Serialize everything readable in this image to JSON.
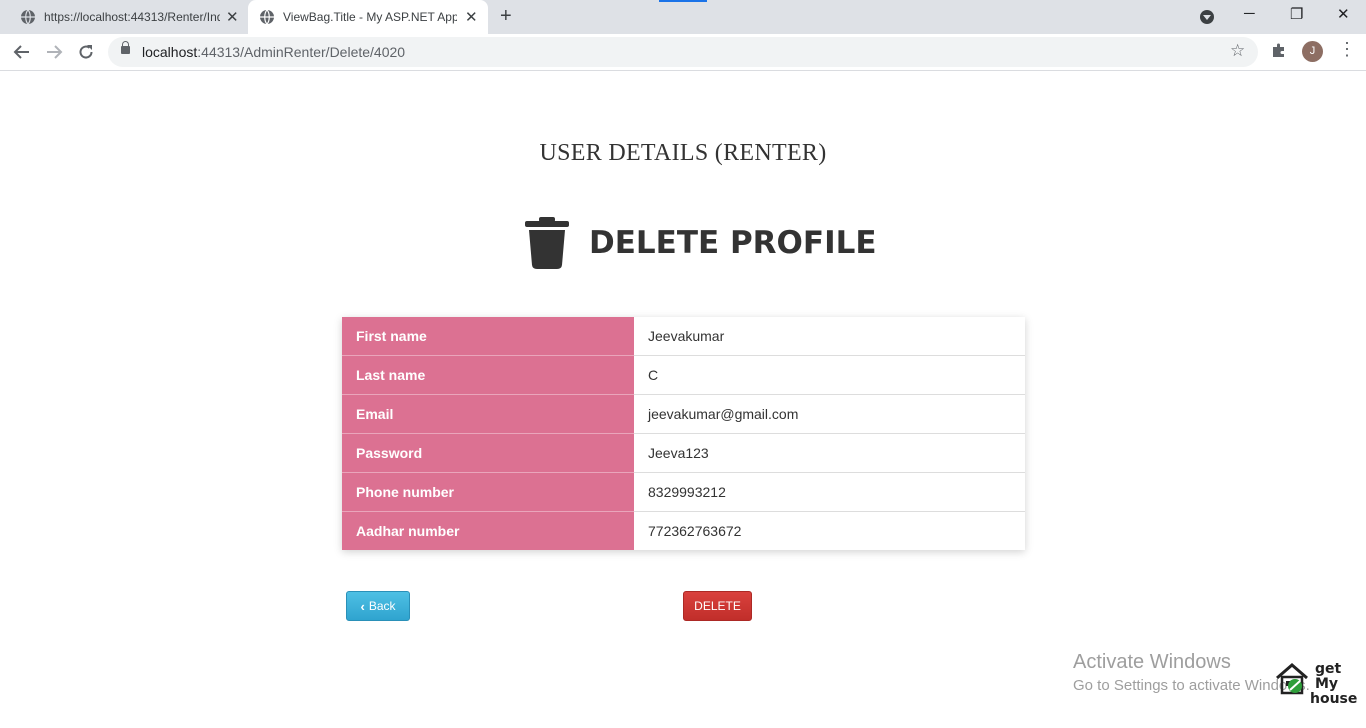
{
  "browser": {
    "tabs": [
      {
        "title": "https://localhost:44313/Renter/Index",
        "active": false
      },
      {
        "title": "ViewBag.Title - My ASP.NET Application",
        "active": true
      }
    ],
    "new_tab_icon": "+",
    "close_icon": "✕",
    "url_host": "localhost",
    "url_path": ":44313/AdminRenter/Delete/4020",
    "avatar_initial": "J",
    "window_controls": {
      "minimize": "─",
      "restore": "❐",
      "close": "✕"
    }
  },
  "page": {
    "heading": "USER DETAILS (RENTER)",
    "delete_title": "DELETE PROFILE",
    "details": [
      {
        "label": "First name",
        "value": "Jeevakumar"
      },
      {
        "label": "Last name",
        "value": "C"
      },
      {
        "label": "Email",
        "value": "jeevakumar@gmail.com"
      },
      {
        "label": "Password",
        "value": "Jeeva123"
      },
      {
        "label": "Phone number",
        "value": "8329993212"
      },
      {
        "label": "Aadhar number",
        "value": "772362763672"
      }
    ],
    "back_label": "Back",
    "delete_label": "DELETE"
  },
  "watermark": {
    "line1": "Activate Windows",
    "line2": "Go to Settings to activate Windows."
  },
  "logo": {
    "line1": "get My",
    "line2": "house"
  },
  "colors": {
    "label_bg": "#dc7192",
    "back_btn": "#31b0d5",
    "delete_btn": "#d9534f"
  }
}
